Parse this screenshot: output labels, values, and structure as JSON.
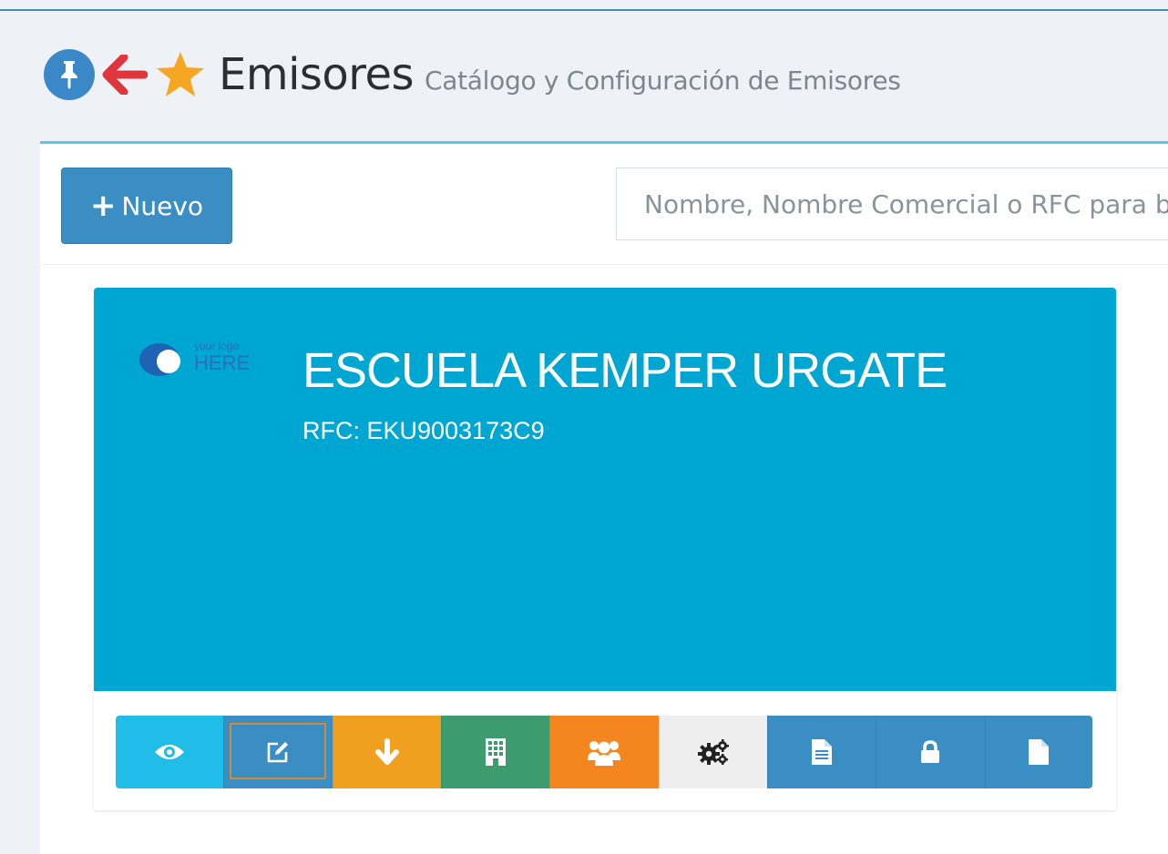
{
  "header": {
    "title": "Emisores",
    "subtitle": "Catálogo y Configuración de Emisores",
    "icons": [
      "pin-icon",
      "back-arrow-icon",
      "star-icon"
    ]
  },
  "toolbar": {
    "new_button_label": "Nuevo",
    "search_placeholder": "Nombre, Nombre Comercial o RFC para b"
  },
  "card": {
    "logo_text_top": "your logo",
    "logo_text_bottom": "HERE",
    "company_name": "ESCUELA KEMPER URGATE",
    "rfc": "RFC: EKU9003173C9",
    "actions": [
      {
        "name": "view",
        "icon": "eye-icon",
        "color": "#1fbde8"
      },
      {
        "name": "edit",
        "icon": "edit-icon",
        "color": "#3b8ec3"
      },
      {
        "name": "download",
        "icon": "arrow-down-icon",
        "color": "#f0a01e"
      },
      {
        "name": "building",
        "icon": "building-icon",
        "color": "#3c9c6e"
      },
      {
        "name": "users",
        "icon": "users-icon",
        "color": "#f5851f"
      },
      {
        "name": "settings",
        "icon": "gears-icon",
        "color": "#eeeeee"
      },
      {
        "name": "document",
        "icon": "file-text-icon",
        "color": "#3b8ec3"
      },
      {
        "name": "lock",
        "icon": "lock-icon",
        "color": "#3b8ec3"
      },
      {
        "name": "blank-document",
        "icon": "file-icon",
        "color": "#3b8ec3"
      }
    ]
  },
  "colors": {
    "accent": "#3b8ec3",
    "banner": "#00a6d2",
    "background": "#eef1f5"
  }
}
